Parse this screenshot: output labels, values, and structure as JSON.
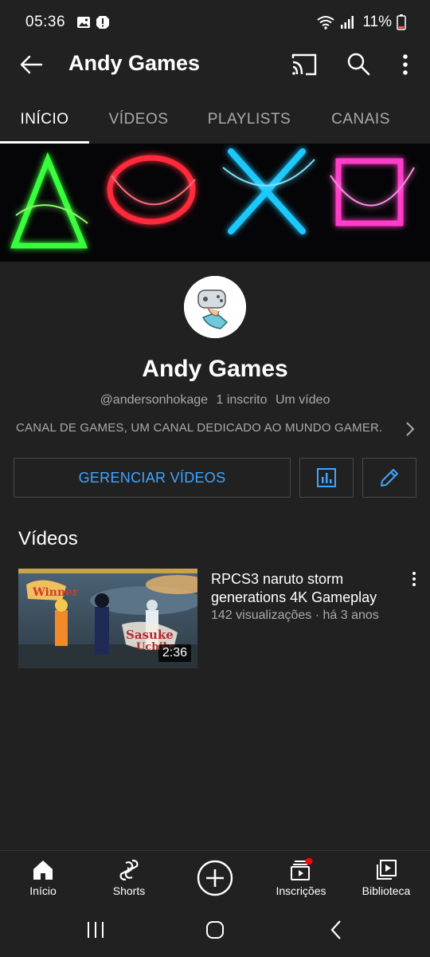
{
  "status_bar": {
    "time": "05:36",
    "battery": "11%"
  },
  "app_bar": {
    "title": "Andy Games",
    "icons": [
      "back-arrow-icon",
      "cast-icon",
      "search-icon",
      "more-vert-icon"
    ]
  },
  "tabs": [
    {
      "label": "INÍCIO",
      "active": true
    },
    {
      "label": "VÍDEOS",
      "active": false
    },
    {
      "label": "PLAYLISTS",
      "active": false
    },
    {
      "label": "CANAIS",
      "active": false
    }
  ],
  "channel": {
    "name": "Andy Games",
    "handle": "@andersonhokage",
    "subscribers": "1 inscrito",
    "video_count": "Um vídeo",
    "description": "CANAL DE GAMES, UM CANAL DEDICADO AO MUNDO GAMER."
  },
  "actions": {
    "manage_videos": "GERENCIAR VÍDEOS"
  },
  "videos_section": {
    "title": "Vídeos",
    "items": [
      {
        "title": "RPCS3 naruto storm generations 4K Gameplay",
        "meta": "142 visualizações · há 3 anos",
        "duration": "2:36"
      }
    ]
  },
  "bottom_nav": [
    {
      "label": "Início",
      "icon": "home-icon"
    },
    {
      "label": "Shorts",
      "icon": "shorts-icon"
    },
    {
      "label": "",
      "icon": "create-icon"
    },
    {
      "label": "Inscrições",
      "icon": "subscriptions-icon"
    },
    {
      "label": "Biblioteca",
      "icon": "library-icon"
    }
  ],
  "colors": {
    "background": "#212121",
    "accent_blue": "#3ea6ff",
    "notification_red": "#ff0000"
  }
}
